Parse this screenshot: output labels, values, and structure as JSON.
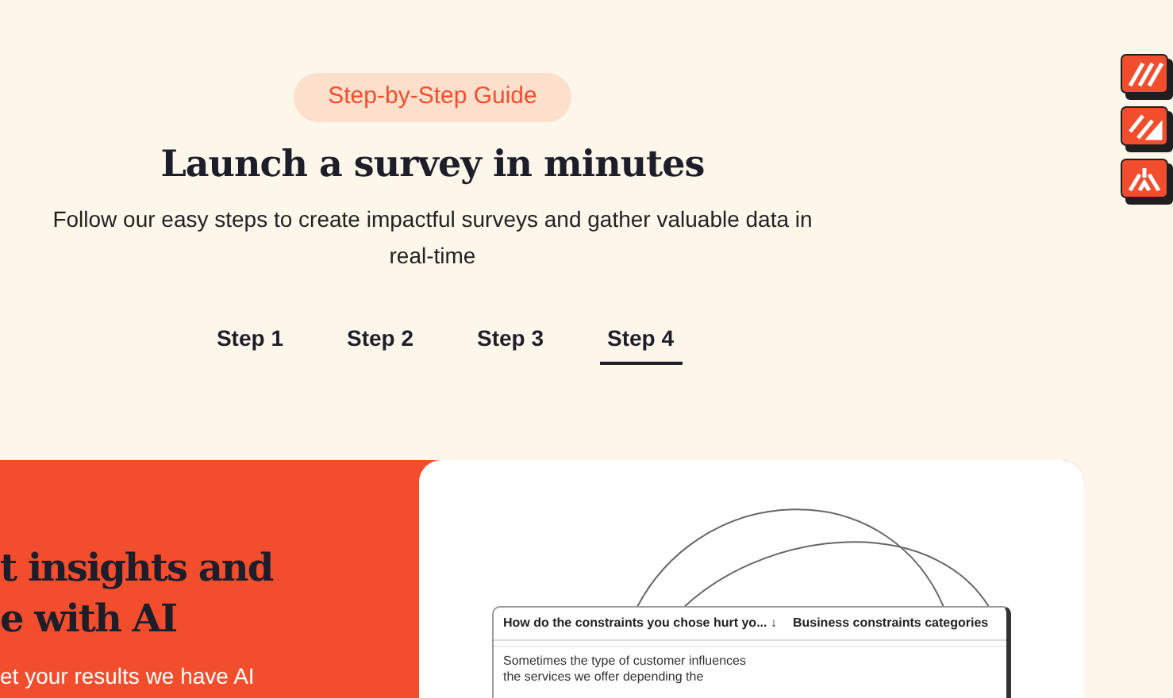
{
  "badge": "Step-by-Step Guide",
  "title": "Launch a survey in minutes",
  "subtitle": "Follow our easy steps to create impactful surveys and gather valuable data in real-time",
  "tabs": [
    {
      "label": "Step 1",
      "selected": false
    },
    {
      "label": "Step 2",
      "selected": false
    },
    {
      "label": "Step 3",
      "selected": false
    },
    {
      "label": "Step 4",
      "selected": true
    }
  ],
  "feature": {
    "heading_lines": [
      "t insights and",
      "e with AI"
    ],
    "text": "et your results we have AI"
  },
  "table": {
    "columns": [
      "How do the constraints you chose hurt yo... ↓",
      "Business constraints categories"
    ],
    "rows": [
      {
        "cell": "Sometimes the type of customer influences the services we offer depending the"
      }
    ]
  }
}
